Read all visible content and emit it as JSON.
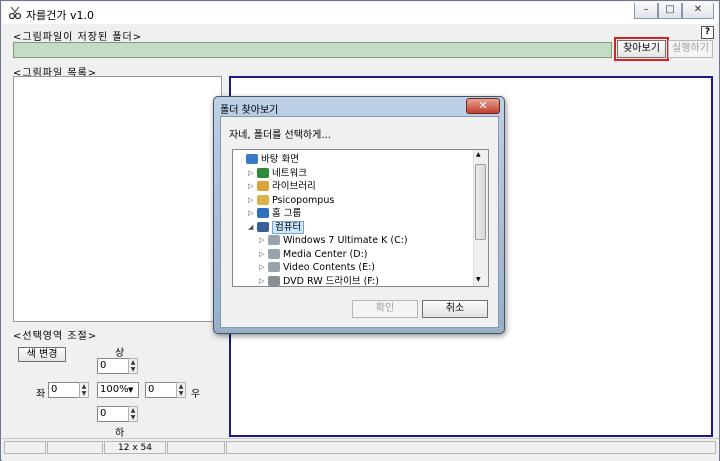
{
  "window": {
    "title": "자를건가 v1.0",
    "minimize": "–",
    "maximize": "□",
    "close": "✕",
    "help": "?"
  },
  "folder_section": {
    "label": "<그림파일이 저장된 폴더>",
    "path_value": "",
    "browse_label": "찾아보기",
    "run_label": "실행하기"
  },
  "file_list": {
    "label": "<그림파일 목록>"
  },
  "selection": {
    "label": "<선택영역 조절>",
    "color_change_label": "색 변경",
    "top_label": "상",
    "bottom_label": "하",
    "left_label": "좌",
    "right_label": "우",
    "top_value": "0",
    "bottom_value": "0",
    "left_value": "0",
    "right_value": "0",
    "zoom_value": "100%"
  },
  "statusbar": {
    "cells": [
      "",
      "",
      "12 x 54",
      "",
      ""
    ]
  },
  "dialog": {
    "title": "폴더 찾아보기",
    "prompt": "자네, 폴더를 선택하게...",
    "ok_label": "확인",
    "cancel_label": "취소",
    "close_label": "✕",
    "tree": [
      {
        "label": "바탕 화면",
        "level": 0,
        "expander": "",
        "icon": "desktop-icon"
      },
      {
        "label": "네트워크",
        "level": 1,
        "expander": "▷",
        "icon": "network-icon"
      },
      {
        "label": "라이브러리",
        "level": 1,
        "expander": "▷",
        "icon": "library-icon"
      },
      {
        "label": "Psicopompus",
        "level": 1,
        "expander": "▷",
        "icon": "user-folder-icon"
      },
      {
        "label": "홈 그룹",
        "level": 1,
        "expander": "▷",
        "icon": "homegroup-icon"
      },
      {
        "label": "컴퓨터",
        "level": 1,
        "expander": "◢",
        "icon": "computer-icon",
        "selected": true
      },
      {
        "label": "Windows 7 Ultimate K (C:)",
        "level": 2,
        "expander": "▷",
        "icon": "drive-icon"
      },
      {
        "label": "Media Center (D:)",
        "level": 2,
        "expander": "▷",
        "icon": "drive-icon"
      },
      {
        "label": "Video Contents (E:)",
        "level": 2,
        "expander": "▷",
        "icon": "drive-icon"
      },
      {
        "label": "DVD RW 드라이브 (F:)",
        "level": 2,
        "expander": "▷",
        "icon": "dvd-drive-icon"
      }
    ]
  },
  "colors": {
    "path_field_bg": "#c4dcc4",
    "canvas_border": "#1a1a8c",
    "highlight_box": "#e02020",
    "selected_tree_item": "#cce8ff"
  }
}
